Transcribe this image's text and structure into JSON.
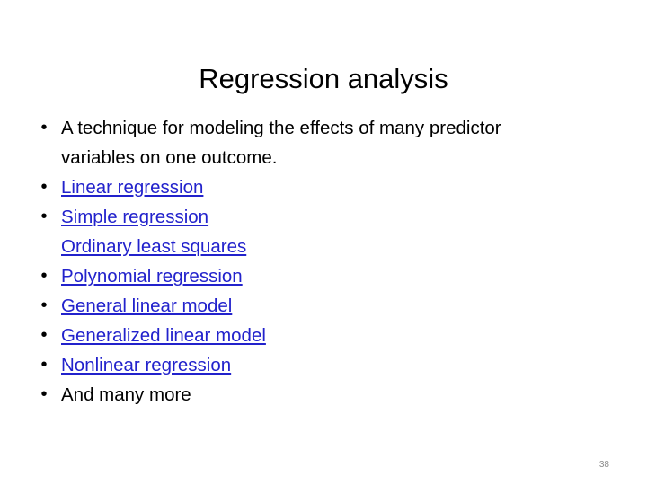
{
  "slide": {
    "title": "Regression analysis",
    "page_number": "38",
    "colors": {
      "background": "#ffffff",
      "title_text": "#000000",
      "body_text": "#000000",
      "hyperlink": "#2222CC",
      "page_number": "#8c8c8c"
    },
    "bullets": [
      {
        "marker": "•",
        "text": "A technique for modeling the effects of many predictor variables on one outcome.",
        "style": "plain"
      },
      {
        "marker": "•",
        "text": "Linear regression",
        "style": "link"
      },
      {
        "marker": "•",
        "text": "Simple regression",
        "style": "link"
      },
      {
        "marker": "",
        "text": "Ordinary least squares",
        "style": "link"
      },
      {
        "marker": "•",
        "text": "Polynomial regression",
        "style": "link"
      },
      {
        "marker": "•",
        "text": "General linear model",
        "style": "link"
      },
      {
        "marker": "•",
        "text": "Generalized linear model",
        "style": "link"
      },
      {
        "marker": "•",
        "text": "Nonlinear regression",
        "style": "link"
      },
      {
        "marker": "•",
        "text": "And many more",
        "style": "plain"
      }
    ]
  }
}
